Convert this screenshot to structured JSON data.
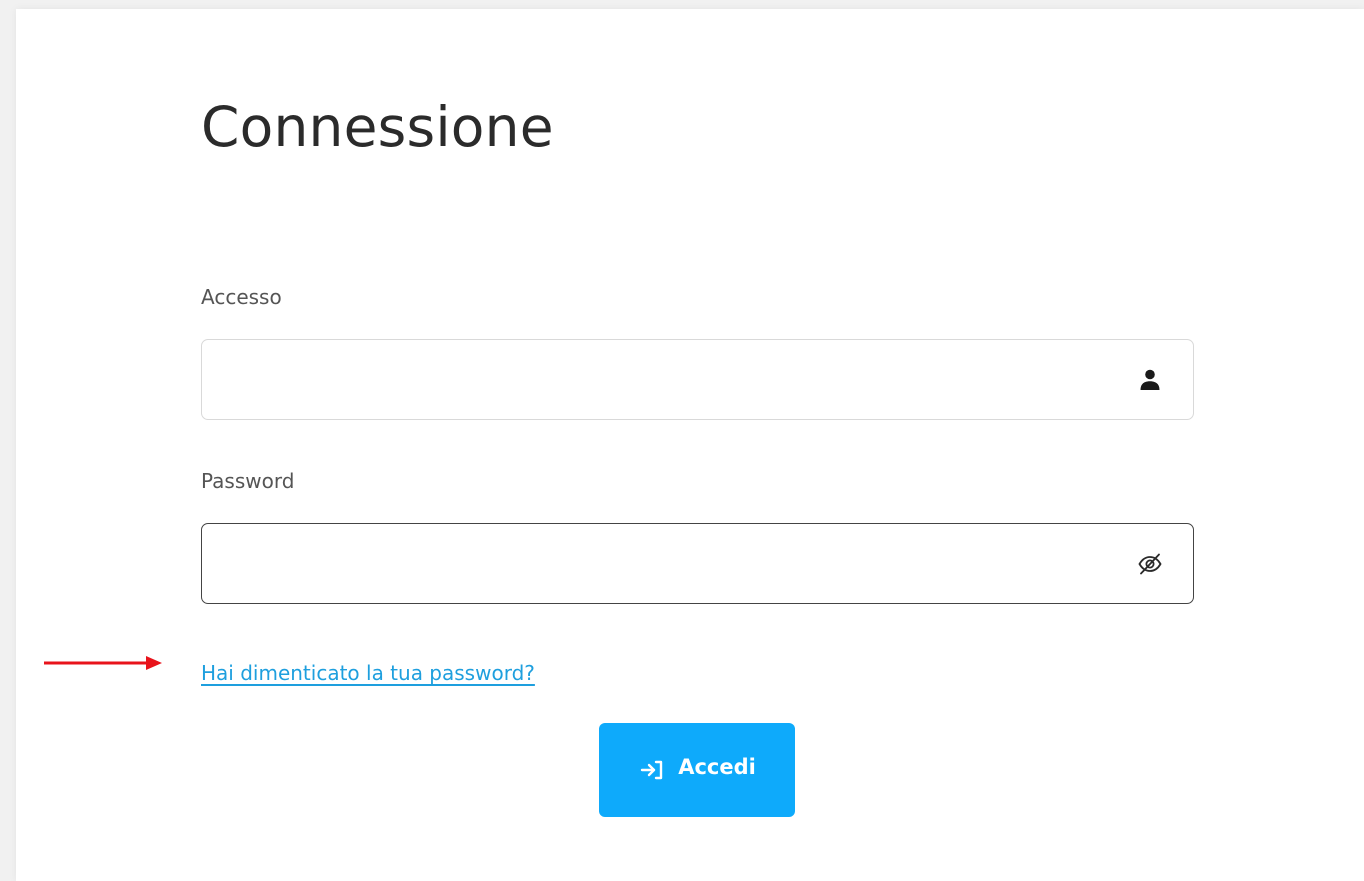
{
  "page": {
    "title": "Connessione"
  },
  "form": {
    "login": {
      "label": "Accesso",
      "value": "",
      "icon": "user-icon"
    },
    "password": {
      "label": "Password",
      "value": "",
      "icon": "eye-off-icon"
    },
    "forgot_link": "Hai dimenticato la tua password?",
    "submit": {
      "label": "Accedi",
      "icon": "login-arrow-icon"
    }
  },
  "colors": {
    "accent": "#0eaafb",
    "link": "#1e9fde",
    "annotation_arrow": "#e8131b",
    "background": "#f1f1f1",
    "card": "#ffffff"
  }
}
